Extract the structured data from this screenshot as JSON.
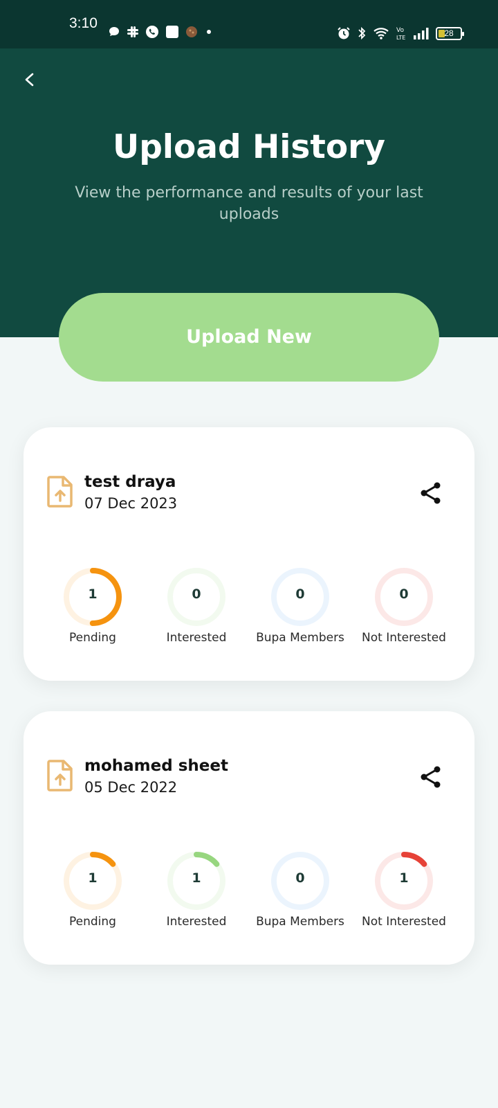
{
  "status_bar": {
    "time": "3:10",
    "battery": "28",
    "left_icons": [
      "chat-bubble-icon",
      "slack-icon",
      "whatsapp-icon",
      "app-square-icon",
      "avatar-icon",
      "dot-icon"
    ],
    "right_icons": [
      "alarm-icon",
      "bluetooth-icon",
      "wifi-icon",
      "volte-icon",
      "signal-icon",
      "battery-icon"
    ]
  },
  "header": {
    "title": "Upload History",
    "subtitle": "View the performance and results of your last uploads",
    "background": "#114a40"
  },
  "upload_button": {
    "label": "Upload New",
    "color": "#a3dc8f"
  },
  "stat_colors": {
    "pending": "#f5930f",
    "interested": "#97d67f",
    "bupa_members": "#5aa6f0",
    "not_interested": "#e64237"
  },
  "uploads": [
    {
      "name": "test draya",
      "date": "07 Dec 2023",
      "stats": [
        {
          "key": "pending",
          "label": "Pending",
          "value": "1",
          "progress": 0.5
        },
        {
          "key": "interested",
          "label": "Interested",
          "value": "0",
          "progress": 0
        },
        {
          "key": "bupa_members",
          "label": "Bupa Members",
          "value": "0",
          "progress": 0
        },
        {
          "key": "not_interested",
          "label": "Not Interested",
          "value": "0",
          "progress": 0
        }
      ]
    },
    {
      "name": "mohamed sheet",
      "date": "05 Dec 2022",
      "stats": [
        {
          "key": "pending",
          "label": "Pending",
          "value": "1",
          "progress": 0.14
        },
        {
          "key": "interested",
          "label": "Interested",
          "value": "1",
          "progress": 0.14
        },
        {
          "key": "bupa_members",
          "label": "Bupa Members",
          "value": "0",
          "progress": 0
        },
        {
          "key": "not_interested",
          "label": "Not Interested",
          "value": "1",
          "progress": 0.14
        }
      ]
    }
  ]
}
